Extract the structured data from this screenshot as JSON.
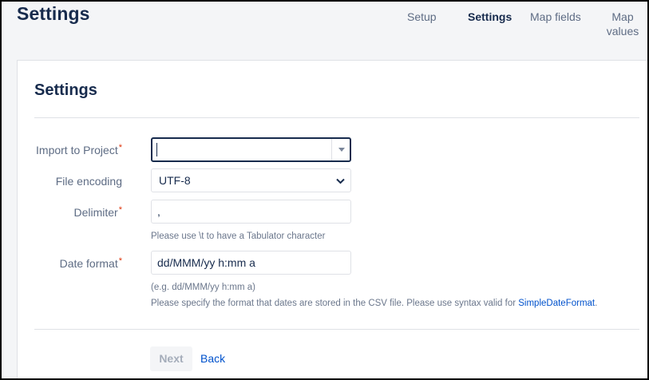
{
  "header": {
    "title": "Settings"
  },
  "nav": {
    "tabs": [
      {
        "label": "Setup",
        "active": false
      },
      {
        "label": "Settings",
        "active": true
      },
      {
        "label": "Map fields",
        "active": false
      },
      {
        "label": "Map values",
        "active": false
      }
    ]
  },
  "form": {
    "title": "Settings",
    "required_marker": "*",
    "import_project": {
      "label": "Import to Project",
      "value": ""
    },
    "file_encoding": {
      "label": "File encoding",
      "value": "UTF-8"
    },
    "delimiter": {
      "label": "Delimiter",
      "value": ",",
      "help": "Please use \\t to have a Tabulator character"
    },
    "date_format": {
      "label": "Date format",
      "value": "dd/MMM/yy h:mm a",
      "example": "(e.g. dd/MMM/yy h:mm a)",
      "help": "Please specify the format that dates are stored in the CSV file. Please use syntax valid for",
      "help_link": "SimpleDateFormat",
      "help_end": "."
    }
  },
  "actions": {
    "next_label": "Next",
    "back_label": "Back"
  },
  "colors": {
    "link": "#0052cc",
    "required": "#de350b",
    "text": "#172b4d",
    "muted": "#5e6c84"
  }
}
